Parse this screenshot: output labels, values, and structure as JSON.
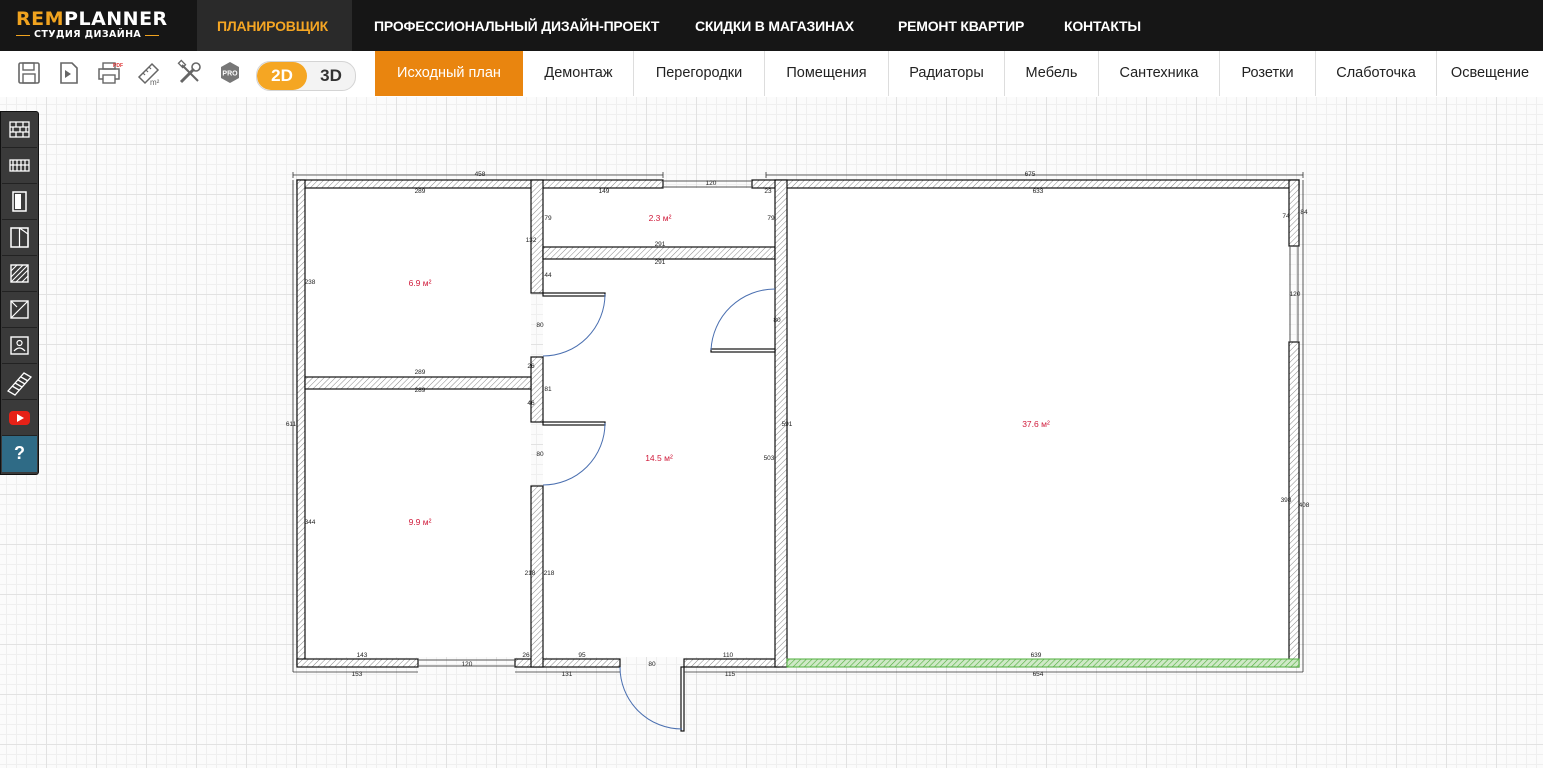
{
  "logo": {
    "main_rem": "REM",
    "main_planner": "PLANNER",
    "sub": "СТУДИЯ ДИЗАЙНА"
  },
  "nav": {
    "items": [
      {
        "label": "ПЛАНИРОВЩИК",
        "active": true
      },
      {
        "label": "ПРОФЕССИОНАЛЬНЫЙ ДИЗАЙН-ПРОЕКТ",
        "active": false
      },
      {
        "label": "СКИДКИ В МАГАЗИНАХ",
        "active": false
      },
      {
        "label": "РЕМОНТ КВАРТИР",
        "active": false
      },
      {
        "label": "КОНТАКТЫ",
        "active": false
      }
    ]
  },
  "toolbar": {
    "icons": [
      "save-icon",
      "open-file-icon",
      "print-pdf-icon",
      "area-ruler-icon",
      "tools-icon",
      "pro-badge-icon"
    ],
    "pro_label": "PRO",
    "mode_2d": "2D",
    "mode_3d": "3D",
    "tabs": [
      {
        "label": "Исходный план",
        "active": true
      },
      {
        "label": "Демонтаж"
      },
      {
        "label": "Перегородки"
      },
      {
        "label": "Помещения"
      },
      {
        "label": "Радиаторы"
      },
      {
        "label": "Мебель"
      },
      {
        "label": "Сантехника"
      },
      {
        "label": "Розетки"
      },
      {
        "label": "Слаботочка"
      },
      {
        "label": "Освещение"
      }
    ]
  },
  "left_panel": {
    "icons": [
      "brick-wall-icon",
      "partition-wall-icon",
      "door-icon",
      "window-icon",
      "hatch-area-icon",
      "opening-icon",
      "room-label-icon",
      "stairs-icon",
      "youtube-icon",
      "help-icon"
    ],
    "help_label": "?"
  },
  "colors": {
    "accent": "#f5a623",
    "tab_active": "#e9850f",
    "area_label": "#d01a3a",
    "balcony": "#4fae3c",
    "door_arc": "#4a6fb0"
  },
  "plan": {
    "rooms": [
      {
        "name": "room-top-left",
        "area": "6.9 м²"
      },
      {
        "name": "room-small",
        "area": "2.3 м²"
      },
      {
        "name": "room-bottom-left",
        "area": "9.9 м²"
      },
      {
        "name": "room-hall",
        "area": "14.5 м²"
      },
      {
        "name": "room-big",
        "area": "37.6 м²"
      }
    ],
    "dims": [
      "458",
      "120",
      "23",
      "675",
      "289",
      "149",
      "79",
      "79",
      "633",
      "74",
      "84",
      "132",
      "291",
      "291",
      "44",
      "238",
      "80",
      "80",
      "120",
      "26",
      "289",
      "289",
      "81",
      "611",
      "46",
      "591",
      "80",
      "503",
      "398",
      "408",
      "344",
      "218",
      "218",
      "143",
      "26",
      "95",
      "110",
      "639",
      "120",
      "80",
      "153",
      "131",
      "115",
      "654"
    ]
  }
}
